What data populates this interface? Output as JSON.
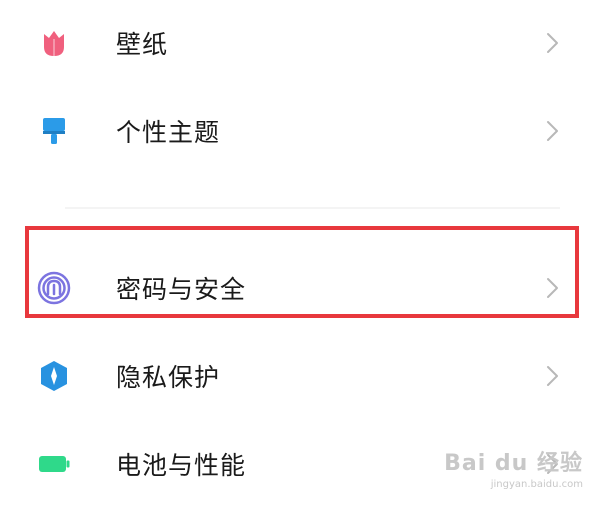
{
  "settings": {
    "items": [
      {
        "label": "壁纸",
        "icon": "wallpaper-icon",
        "color": "#f0607e"
      },
      {
        "label": "个性主题",
        "icon": "theme-brush-icon",
        "color": "#2b9be8"
      },
      {
        "label": "密码与安全",
        "icon": "fingerprint-icon",
        "color": "#7c74e0"
      },
      {
        "label": "隐私保护",
        "icon": "privacy-shield-icon",
        "color": "#2892e0"
      },
      {
        "label": "电池与性能",
        "icon": "battery-icon",
        "color": "#2fd98a"
      }
    ],
    "highlighted_item": "密码与安全",
    "highlight_color": "#e8383d"
  },
  "watermark": {
    "main": "Bai du 经验",
    "sub": "jingyan.baidu.com"
  }
}
